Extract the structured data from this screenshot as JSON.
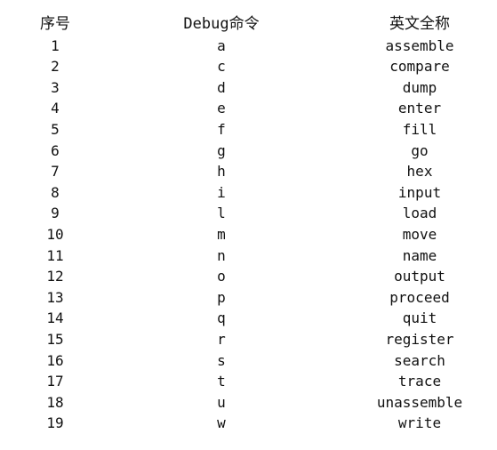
{
  "table": {
    "headers": [
      "序号",
      "Debug命令",
      "英文全称"
    ],
    "rows": [
      [
        "1",
        "a",
        "assemble"
      ],
      [
        "2",
        "c",
        "compare"
      ],
      [
        "3",
        "d",
        "dump"
      ],
      [
        "4",
        "e",
        "enter"
      ],
      [
        "5",
        "f",
        "fill"
      ],
      [
        "6",
        "g",
        "go"
      ],
      [
        "7",
        "h",
        "hex"
      ],
      [
        "8",
        "i",
        "input"
      ],
      [
        "9",
        "l",
        "load"
      ],
      [
        "10",
        "m",
        "move"
      ],
      [
        "11",
        "n",
        "name"
      ],
      [
        "12",
        "o",
        "output"
      ],
      [
        "13",
        "p",
        "proceed"
      ],
      [
        "14",
        "q",
        "quit"
      ],
      [
        "15",
        "r",
        "register"
      ],
      [
        "16",
        "s",
        "search"
      ],
      [
        "17",
        "t",
        "trace"
      ],
      [
        "18",
        "u",
        "unassemble"
      ],
      [
        "19",
        "w",
        "write"
      ]
    ]
  }
}
